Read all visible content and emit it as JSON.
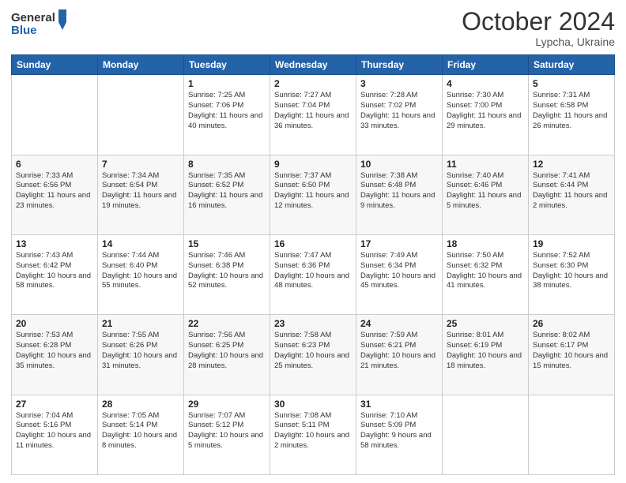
{
  "header": {
    "logo_line1": "General",
    "logo_line2": "Blue",
    "month_title": "October 2024",
    "location": "Lypcha, Ukraine"
  },
  "days_of_week": [
    "Sunday",
    "Monday",
    "Tuesday",
    "Wednesday",
    "Thursday",
    "Friday",
    "Saturday"
  ],
  "weeks": [
    [
      {
        "day": "",
        "info": ""
      },
      {
        "day": "",
        "info": ""
      },
      {
        "day": "1",
        "info": "Sunrise: 7:25 AM\nSunset: 7:06 PM\nDaylight: 11 hours and 40 minutes."
      },
      {
        "day": "2",
        "info": "Sunrise: 7:27 AM\nSunset: 7:04 PM\nDaylight: 11 hours and 36 minutes."
      },
      {
        "day": "3",
        "info": "Sunrise: 7:28 AM\nSunset: 7:02 PM\nDaylight: 11 hours and 33 minutes."
      },
      {
        "day": "4",
        "info": "Sunrise: 7:30 AM\nSunset: 7:00 PM\nDaylight: 11 hours and 29 minutes."
      },
      {
        "day": "5",
        "info": "Sunrise: 7:31 AM\nSunset: 6:58 PM\nDaylight: 11 hours and 26 minutes."
      }
    ],
    [
      {
        "day": "6",
        "info": "Sunrise: 7:33 AM\nSunset: 6:56 PM\nDaylight: 11 hours and 23 minutes."
      },
      {
        "day": "7",
        "info": "Sunrise: 7:34 AM\nSunset: 6:54 PM\nDaylight: 11 hours and 19 minutes."
      },
      {
        "day": "8",
        "info": "Sunrise: 7:35 AM\nSunset: 6:52 PM\nDaylight: 11 hours and 16 minutes."
      },
      {
        "day": "9",
        "info": "Sunrise: 7:37 AM\nSunset: 6:50 PM\nDaylight: 11 hours and 12 minutes."
      },
      {
        "day": "10",
        "info": "Sunrise: 7:38 AM\nSunset: 6:48 PM\nDaylight: 11 hours and 9 minutes."
      },
      {
        "day": "11",
        "info": "Sunrise: 7:40 AM\nSunset: 6:46 PM\nDaylight: 11 hours and 5 minutes."
      },
      {
        "day": "12",
        "info": "Sunrise: 7:41 AM\nSunset: 6:44 PM\nDaylight: 11 hours and 2 minutes."
      }
    ],
    [
      {
        "day": "13",
        "info": "Sunrise: 7:43 AM\nSunset: 6:42 PM\nDaylight: 10 hours and 58 minutes."
      },
      {
        "day": "14",
        "info": "Sunrise: 7:44 AM\nSunset: 6:40 PM\nDaylight: 10 hours and 55 minutes."
      },
      {
        "day": "15",
        "info": "Sunrise: 7:46 AM\nSunset: 6:38 PM\nDaylight: 10 hours and 52 minutes."
      },
      {
        "day": "16",
        "info": "Sunrise: 7:47 AM\nSunset: 6:36 PM\nDaylight: 10 hours and 48 minutes."
      },
      {
        "day": "17",
        "info": "Sunrise: 7:49 AM\nSunset: 6:34 PM\nDaylight: 10 hours and 45 minutes."
      },
      {
        "day": "18",
        "info": "Sunrise: 7:50 AM\nSunset: 6:32 PM\nDaylight: 10 hours and 41 minutes."
      },
      {
        "day": "19",
        "info": "Sunrise: 7:52 AM\nSunset: 6:30 PM\nDaylight: 10 hours and 38 minutes."
      }
    ],
    [
      {
        "day": "20",
        "info": "Sunrise: 7:53 AM\nSunset: 6:28 PM\nDaylight: 10 hours and 35 minutes."
      },
      {
        "day": "21",
        "info": "Sunrise: 7:55 AM\nSunset: 6:26 PM\nDaylight: 10 hours and 31 minutes."
      },
      {
        "day": "22",
        "info": "Sunrise: 7:56 AM\nSunset: 6:25 PM\nDaylight: 10 hours and 28 minutes."
      },
      {
        "day": "23",
        "info": "Sunrise: 7:58 AM\nSunset: 6:23 PM\nDaylight: 10 hours and 25 minutes."
      },
      {
        "day": "24",
        "info": "Sunrise: 7:59 AM\nSunset: 6:21 PM\nDaylight: 10 hours and 21 minutes."
      },
      {
        "day": "25",
        "info": "Sunrise: 8:01 AM\nSunset: 6:19 PM\nDaylight: 10 hours and 18 minutes."
      },
      {
        "day": "26",
        "info": "Sunrise: 8:02 AM\nSunset: 6:17 PM\nDaylight: 10 hours and 15 minutes."
      }
    ],
    [
      {
        "day": "27",
        "info": "Sunrise: 7:04 AM\nSunset: 5:16 PM\nDaylight: 10 hours and 11 minutes."
      },
      {
        "day": "28",
        "info": "Sunrise: 7:05 AM\nSunset: 5:14 PM\nDaylight: 10 hours and 8 minutes."
      },
      {
        "day": "29",
        "info": "Sunrise: 7:07 AM\nSunset: 5:12 PM\nDaylight: 10 hours and 5 minutes."
      },
      {
        "day": "30",
        "info": "Sunrise: 7:08 AM\nSunset: 5:11 PM\nDaylight: 10 hours and 2 minutes."
      },
      {
        "day": "31",
        "info": "Sunrise: 7:10 AM\nSunset: 5:09 PM\nDaylight: 9 hours and 58 minutes."
      },
      {
        "day": "",
        "info": ""
      },
      {
        "day": "",
        "info": ""
      }
    ]
  ]
}
